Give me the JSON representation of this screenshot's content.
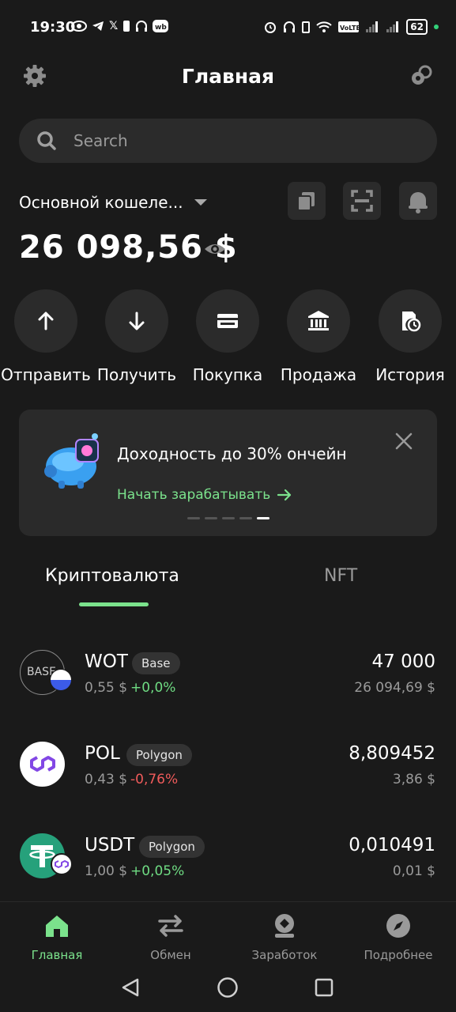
{
  "status_bar": {
    "time": "19:30",
    "battery": "62"
  },
  "header": {
    "title": "Главная"
  },
  "search": {
    "placeholder": "Search"
  },
  "wallet": {
    "name": "Основной кошеле...",
    "balance": "26 098,56 $"
  },
  "actions": [
    {
      "label": "Отправить",
      "icon": "arrow-up-icon"
    },
    {
      "label": "Получить",
      "icon": "arrow-down-icon"
    },
    {
      "label": "Покупка",
      "icon": "card-icon"
    },
    {
      "label": "Продажа",
      "icon": "bank-icon"
    },
    {
      "label": "История",
      "icon": "history-icon"
    }
  ],
  "banner": {
    "title": "Доходность до 30% ончейн",
    "link": "Начать зарабатывать",
    "slides": 5,
    "active_slide": 5
  },
  "tabs": {
    "crypto": "Криптовалюта",
    "nft": "NFT"
  },
  "assets": [
    {
      "symbol": "WOT",
      "network": "Base",
      "price": "0,55 $",
      "change": "+0,0%",
      "amount": "47 000",
      "fiat": "26 094,69 $",
      "logo_text": "BASE"
    },
    {
      "symbol": "POL",
      "network": "Polygon",
      "price": "0,43 $",
      "change": "-0,76%",
      "amount": "8,809452",
      "fiat": "3,86 $"
    },
    {
      "symbol": "USDT",
      "network": "Polygon",
      "price": "1,00 $",
      "change": "+0,05%",
      "amount": "0,010491",
      "fiat": "0,01 $"
    }
  ],
  "bottom_nav": [
    {
      "label": "Главная",
      "icon": "home-icon",
      "active": true
    },
    {
      "label": "Обмен",
      "icon": "swap-icon",
      "active": false
    },
    {
      "label": "Заработок",
      "icon": "earn-icon",
      "active": false
    },
    {
      "label": "Подробнее",
      "icon": "discover-icon",
      "active": false
    }
  ],
  "colors": {
    "background": "#1a1a1a",
    "card": "#2b2b2b",
    "accent": "#7be28c",
    "negative": "#f05b5b"
  }
}
